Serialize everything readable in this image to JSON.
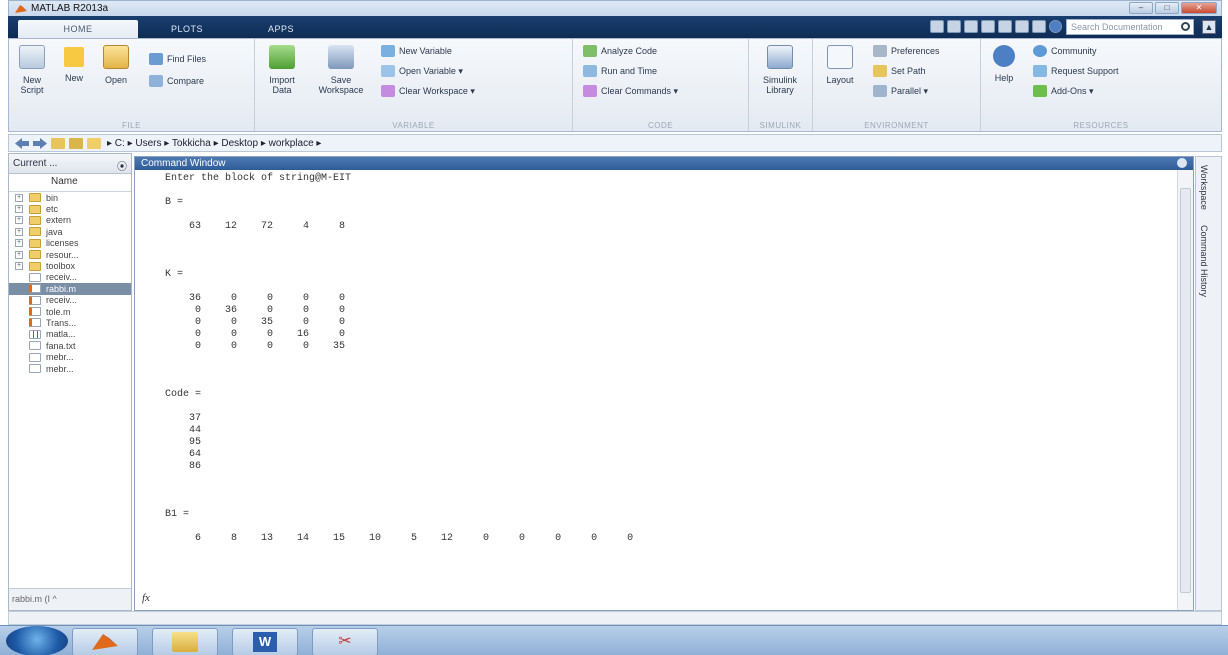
{
  "window": {
    "title": "MATLAB R2013a"
  },
  "tabs": [
    {
      "label": "HOME"
    },
    {
      "label": "PLOTS"
    },
    {
      "label": "APPS"
    }
  ],
  "search": {
    "placeholder": "Search Documentation"
  },
  "ribbon": {
    "file": {
      "label": "FILE",
      "new_script": "New Script",
      "new": "New",
      "open": "Open",
      "find_files": "Find Files",
      "compare": "Compare"
    },
    "variable": {
      "label": "VARIABLE",
      "import_data": "Import Data",
      "save_workspace": "Save Workspace",
      "new_variable": "New Variable",
      "open_variable": "Open Variable ▾",
      "clear_workspace": "Clear Workspace ▾"
    },
    "code": {
      "label": "CODE",
      "analyze_code": "Analyze Code",
      "run_and_time": "Run and Time",
      "clear_commands": "Clear Commands ▾"
    },
    "simulink": {
      "label": "SIMULINK",
      "simulink_library": "Simulink Library"
    },
    "environment": {
      "label": "ENVIRONMENT",
      "layout": "Layout",
      "preferences": "Preferences",
      "set_path": "Set Path",
      "parallel": "Parallel ▾"
    },
    "resources": {
      "label": "RESOURCES",
      "help": "Help",
      "community": "Community",
      "request_support": "Request Support",
      "add_ons": "Add-Ons ▾"
    }
  },
  "address": {
    "path": "▸ C: ▸ Users ▸ Tokkicha ▸ Desktop ▸ workplace ▸"
  },
  "current_folder": {
    "title": "Current ...",
    "column": "Name",
    "items": [
      {
        "label": "bin",
        "type": "folder"
      },
      {
        "label": "etc",
        "type": "folder"
      },
      {
        "label": "extern",
        "type": "folder"
      },
      {
        "label": "java",
        "type": "folder"
      },
      {
        "label": "licenses",
        "type": "folder"
      },
      {
        "label": "resour...",
        "type": "folder"
      },
      {
        "label": "toolbox",
        "type": "folder"
      },
      {
        "label": "receiv...",
        "type": "file"
      },
      {
        "label": "rabbi.m",
        "type": "mfile",
        "selected": true
      },
      {
        "label": "receiv...",
        "type": "mfile"
      },
      {
        "label": "tole.m",
        "type": "mfile"
      },
      {
        "label": "Trans...",
        "type": "mfile"
      },
      {
        "label": "matla...",
        "type": "mat"
      },
      {
        "label": "fana.txt",
        "type": "file"
      },
      {
        "label": "mebr...",
        "type": "file"
      },
      {
        "label": "mebr...",
        "type": "file"
      }
    ],
    "footer": "rabbi.m (I ^"
  },
  "command_window": {
    "title": "Command Window",
    "prompt_symbol": "fx",
    "lines": [
      "Enter the block of string@M-EIT",
      "",
      "B =",
      "",
      "    63    12    72     4     8",
      "",
      "",
      "",
      "K =",
      "",
      "    36     0     0     0     0",
      "     0    36     0     0     0",
      "     0     0    35     0     0",
      "     0     0     0    16     0",
      "     0     0     0     0    35",
      "",
      "",
      "",
      "Code =",
      "",
      "    37",
      "    44",
      "    95",
      "    64",
      "    86",
      "",
      "",
      "",
      "B1 =",
      "",
      "     6     8    13    14    15    10     5    12     0     0     0     0     0"
    ]
  },
  "right_dock": {
    "workspace": "Workspace",
    "command_history": "Command History"
  },
  "colors": {
    "accent": "#2f5b97",
    "tabbar": "#0f2c55",
    "selection": "#7a8ea6"
  }
}
